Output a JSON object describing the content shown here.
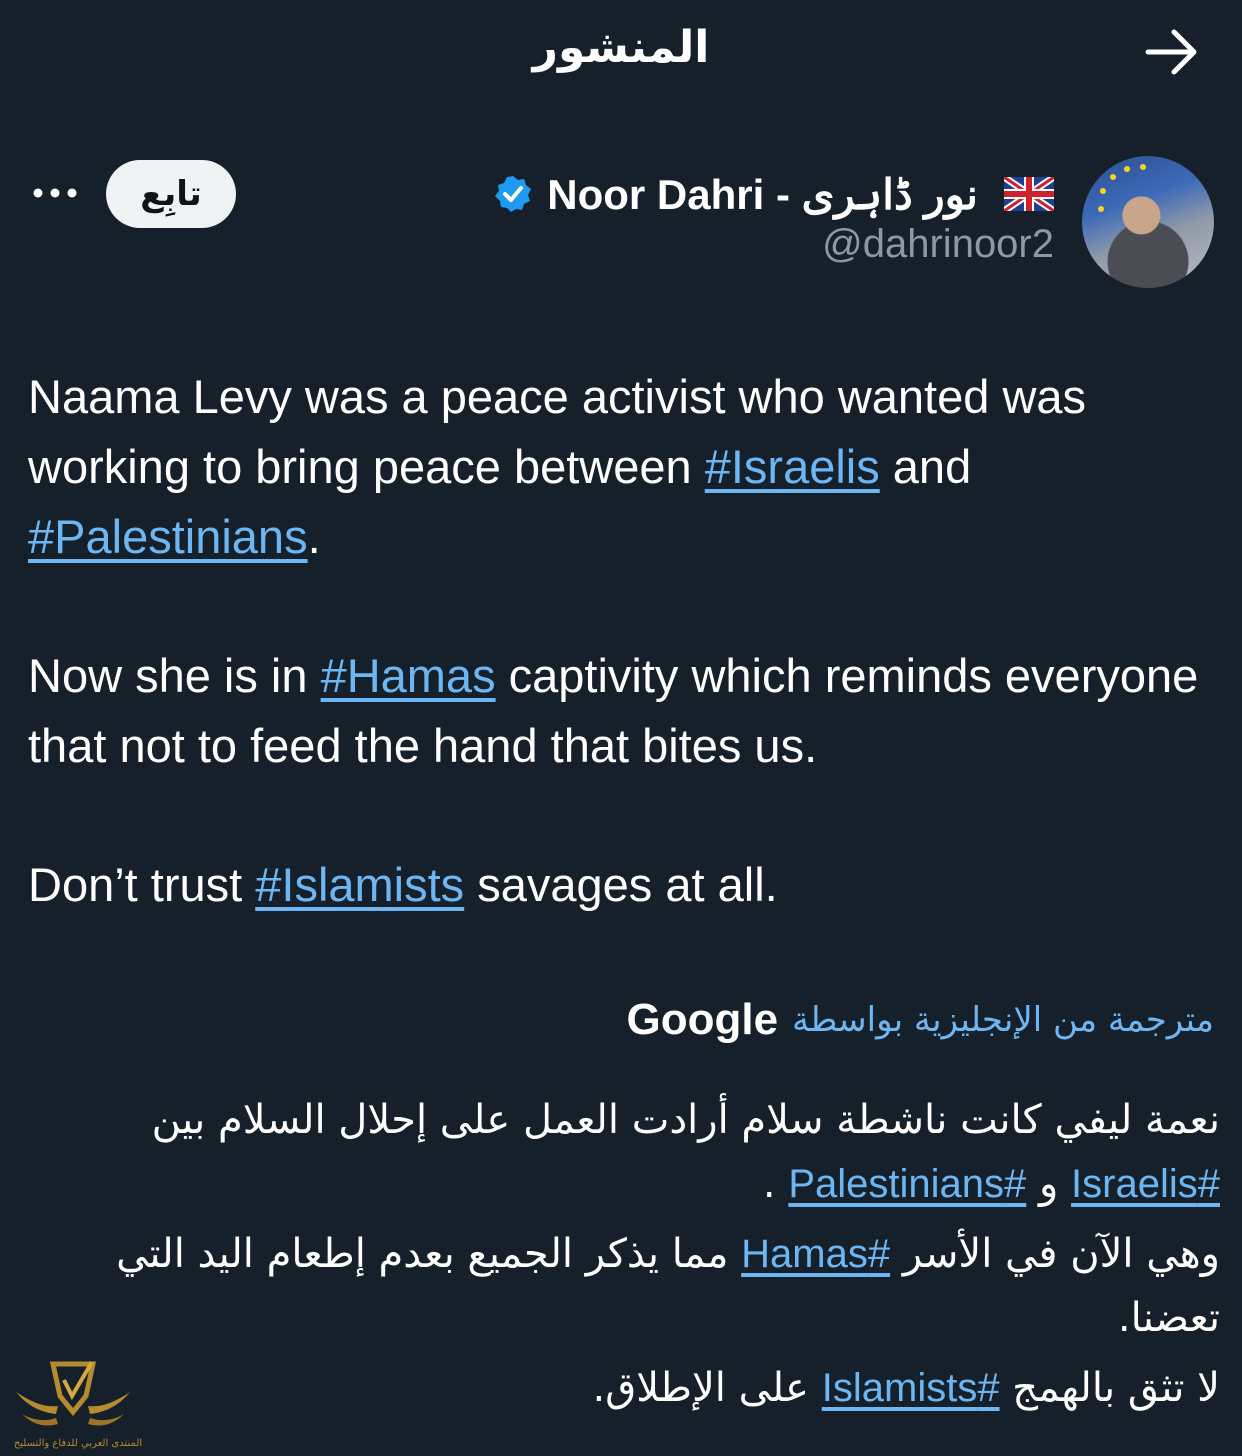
{
  "header": {
    "title": "المنشور"
  },
  "author": {
    "display_name": "Noor Dahri - نور ڈاہری",
    "handle": "@dahrinoor2",
    "verified": true,
    "flag": "uk-flag",
    "follow_label": "تابِع"
  },
  "tweet": {
    "p1": {
      "text1": "Naama Levy was a peace activist who wanted was working to bring peace between ",
      "tag1": "#Israelis",
      "text2": " and ",
      "tag2": "#Palestinians",
      "text3": "."
    },
    "p2": {
      "text1": "Now she is in ",
      "tag1": "#Hamas",
      "text2": " captivity which reminds everyone that not to feed the hand that bites us."
    },
    "p3": {
      "text1": "Don’t trust ",
      "tag1": "#Islamists",
      "text2": " savages at all."
    }
  },
  "translation": {
    "label": "مترجمة من الإنجليزية بواسطة",
    "provider": "Google",
    "p1": {
      "text1": "نعمة ليفي كانت ناشطة سلام أرادت العمل على إحلال السلام بين ",
      "tag1": "#Israelis",
      "text2": " و ",
      "tag2": "#Palestinians",
      "text3": " ."
    },
    "p2": {
      "text1": "وهي الآن في الأسر ",
      "tag1": "#Hamas",
      "text2": " مما يذكر الجميع بعدم إطعام اليد التي تعضنا."
    },
    "p3": {
      "text1": "لا تثق بالهمج ",
      "tag1": "#Islamists",
      "text2": " على الإطلاق."
    }
  },
  "watermark": {
    "text": "المنتدى العربي للدفاع والتسليح"
  },
  "colors": {
    "background": "#15202b",
    "link": "#6cb6f3",
    "verified": "#1d9bf0",
    "muted": "#8b98a5"
  }
}
